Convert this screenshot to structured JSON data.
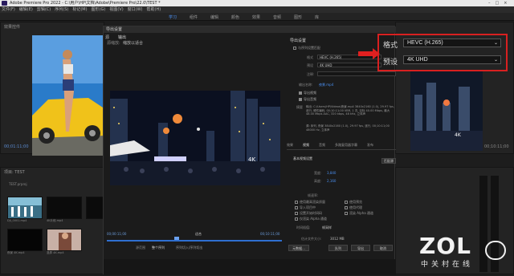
{
  "window": {
    "title": "Adobe Premiere Pro 2022 - C:\\用户\\HP\\文档\\Adobe\\Premiere Pro\\22.0\\TEST *"
  },
  "menu": [
    "文件(F)",
    "编辑(E)",
    "剪辑(C)",
    "序列(S)",
    "标记(M)",
    "图形(G)",
    "视图(V)",
    "窗口(W)",
    "帮助(H)"
  ],
  "workspaces": [
    "学习",
    "组件",
    "编辑",
    "颜色",
    "效果",
    "音频",
    "图形",
    "库"
  ],
  "left_panel": {
    "tab": "效果控件",
    "timecode": "00;01:11;00"
  },
  "project": {
    "title": "项目: TEST",
    "file": "TEST.prproj",
    "items": [
      "DJI_0001.mp4",
      "4K片段.mp4",
      "4K片段.mp4",
      "",
      "夜景 4K.mp4",
      "竖屏 4K.mp4"
    ]
  },
  "export_dialog": {
    "title": "导出设置",
    "source_tabs": [
      "源",
      "输出"
    ],
    "source_scaling_label": "源缩放:",
    "source_scaling": "缩放以适合",
    "start_time": "00;00:11;00",
    "end_time": "00;10:11;00",
    "fit": "适合",
    "range_label": "源范围",
    "range": "整个序列",
    "range_panel": "序列切入/序列切出",
    "settings_header": "导出设置",
    "match_sequence": "与序列设置匹配",
    "format_label": "格式",
    "format": "HEVC (H.265)",
    "preset_label": "预设",
    "preset": "4K UHD",
    "comment_label": "注释:",
    "output_name_label": "输出名称:",
    "output_name": "夜景.mp4",
    "export_video": "导出视频",
    "export_audio": "导出音频",
    "summary_label": "摘要",
    "summary_output": "输出: C:\\Users\\HP\\Videos\\夜景.mp4 3840x2160 (1.0), 29.97 fps, 逐行, 硬件编码, 00;10:11;00 VBR, 1 次, 目标 40.00 Mbps, 最大 48.00 Mbps AAC, 320 kbps, 48 kHz, 立体声",
    "summary_source": "源: 序列, 夜景 3840x2160 (1.0), 29.97 fps, 逐行, 00;10:11;00 48000 Hz, 立体声",
    "tabs": [
      "效果",
      "视频",
      "音频",
      "多路复用器",
      "字幕",
      "发布"
    ],
    "basic_settings": "基本视频设置",
    "match_source": "匹配源",
    "width_label": "宽度:",
    "width": "3,840",
    "height_label": "高度:",
    "height": "2,160",
    "framerate_label": "帧速率:",
    "options": [
      "使用最高渲染质量",
      "导入项目中",
      "设置开始时间码",
      "仅渲染 Alpha 通道",
      "使用预览",
      "使用代理",
      "渲染 Alpha 通道"
    ],
    "interpolation_label": "时间插值:",
    "interpolation": "帧采样",
    "filesize_label": "估计文件大小:",
    "filesize": "3012 MB",
    "metadata_button": "元数据...",
    "queue_button": "队列",
    "export_button": "导出",
    "cancel_button": "取消"
  },
  "program": {
    "timecode": "00;00:00;00",
    "duration": "00;10:11;00"
  },
  "watermark": {
    "brand": "ZOL",
    "sub": "中关村在线"
  },
  "video_badge": "4K"
}
